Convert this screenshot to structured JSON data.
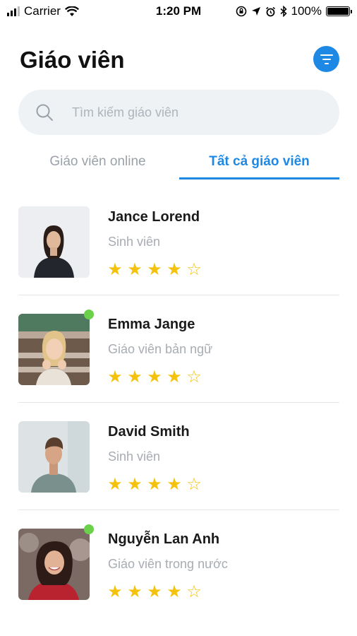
{
  "status_bar": {
    "carrier": "Carrier",
    "time": "1:20 PM",
    "battery": "100%",
    "battery_level": 1.0
  },
  "header": {
    "title": "Giáo viên"
  },
  "search": {
    "placeholder": "Tìm kiếm giáo viên",
    "value": ""
  },
  "tabs": [
    {
      "label": "Giáo viên online",
      "active": false
    },
    {
      "label": "Tất cả giáo viên",
      "active": true
    }
  ],
  "teachers": [
    {
      "name": "Jance Lorend",
      "role": "Sinh viên",
      "rating": 4,
      "max_rating": 5,
      "online": false
    },
    {
      "name": "Emma Jange",
      "role": "Giáo viên bản ngữ",
      "rating": 4,
      "max_rating": 5,
      "online": true
    },
    {
      "name": "David Smith",
      "role": "Sinh viên",
      "rating": 4,
      "max_rating": 5,
      "online": false
    },
    {
      "name": "Nguyễn Lan Anh",
      "role": "Giáo viên trong nước",
      "rating": 4,
      "max_rating": 5,
      "online": true
    }
  ],
  "icons": {
    "filter": "filter-icon",
    "search": "search-icon",
    "wifi": "wifi-icon"
  },
  "colors": {
    "accent": "#1e88e5",
    "star": "#f5c20b",
    "online": "#6bd14b"
  }
}
